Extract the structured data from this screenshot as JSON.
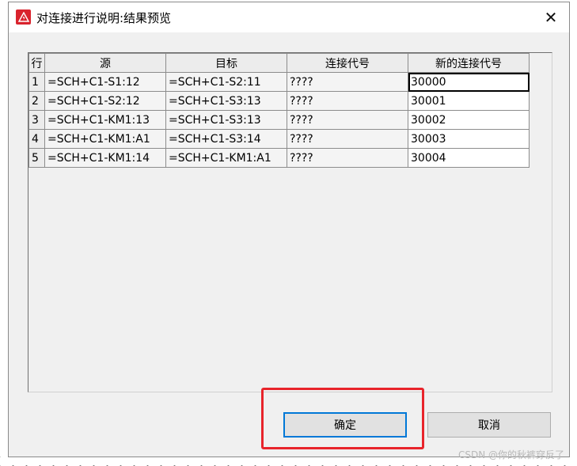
{
  "window": {
    "title": "对连接进行说明:结果预览",
    "close_label": "✕"
  },
  "table": {
    "headers": [
      "行",
      "源",
      "目标",
      "连接代号",
      "新的连接代号"
    ],
    "rows": [
      {
        "num": "1",
        "source": "=SCH+C1-S1:12",
        "target": "=SCH+C1-S2:11",
        "code": "????",
        "new_code": "30000"
      },
      {
        "num": "2",
        "source": "=SCH+C1-S2:12",
        "target": "=SCH+C1-S3:13",
        "code": "????",
        "new_code": "30001"
      },
      {
        "num": "3",
        "source": "=SCH+C1-KM1:13",
        "target": "=SCH+C1-S3:13",
        "code": "????",
        "new_code": "30002"
      },
      {
        "num": "4",
        "source": "=SCH+C1-KM1:A1",
        "target": "=SCH+C1-S3:14",
        "code": "????",
        "new_code": "30003"
      },
      {
        "num": "5",
        "source": "=SCH+C1-KM1:14",
        "target": "=SCH+C1-KM1:A1",
        "code": "????",
        "new_code": "30004"
      }
    ]
  },
  "buttons": {
    "ok": "确定",
    "cancel": "取消"
  },
  "watermark": "CSDN @你的秋裤穿反了",
  "colors": {
    "highlight": "#e8242b",
    "focus_border": "#0078d7",
    "app_icon": "#d9232d"
  }
}
